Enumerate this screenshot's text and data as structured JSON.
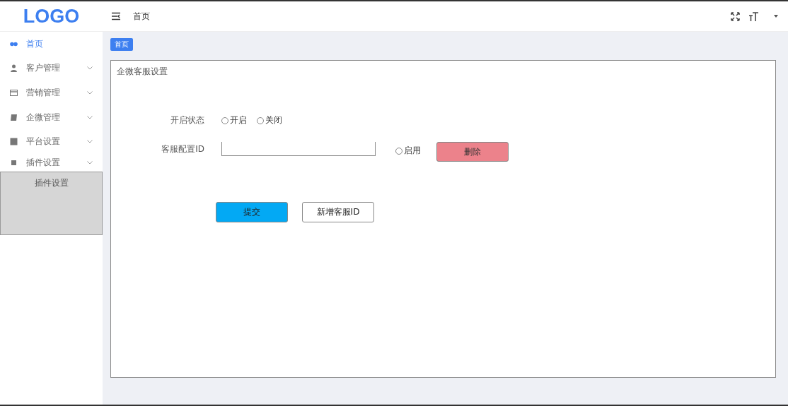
{
  "header": {
    "logo": "LOGO",
    "breadcrumb": "首页"
  },
  "sidebar": {
    "items": [
      {
        "label": "首页",
        "kind": "dashboard",
        "selected": true,
        "expandable": false
      },
      {
        "label": "客户管理",
        "kind": "user",
        "selected": false,
        "expandable": true
      },
      {
        "label": "营销管理",
        "kind": "card",
        "selected": false,
        "expandable": true
      },
      {
        "label": "企微管理",
        "kind": "book",
        "selected": false,
        "expandable": true
      },
      {
        "label": "平台设置",
        "kind": "box",
        "selected": false,
        "expandable": true
      },
      {
        "label": "插件设置",
        "kind": "square",
        "selected": false,
        "expandable": true
      }
    ],
    "flyout": {
      "items": [
        "插件设置"
      ]
    }
  },
  "tags": [
    {
      "label": "首页",
      "selected": true
    }
  ],
  "panel": {
    "title": "企微客服设置",
    "status": {
      "label": "开启状态",
      "options": [
        {
          "label": "开启",
          "checked": false
        },
        {
          "label": "关闭",
          "checked": false
        }
      ]
    },
    "config": {
      "label": "客服配置ID",
      "enable": {
        "label": "启用",
        "checked": false
      },
      "delete_button": "删除"
    },
    "buttons": [
      {
        "label": "提交",
        "kind": "primary"
      },
      {
        "label": "新增客服ID",
        "kind": "plain"
      }
    ]
  }
}
